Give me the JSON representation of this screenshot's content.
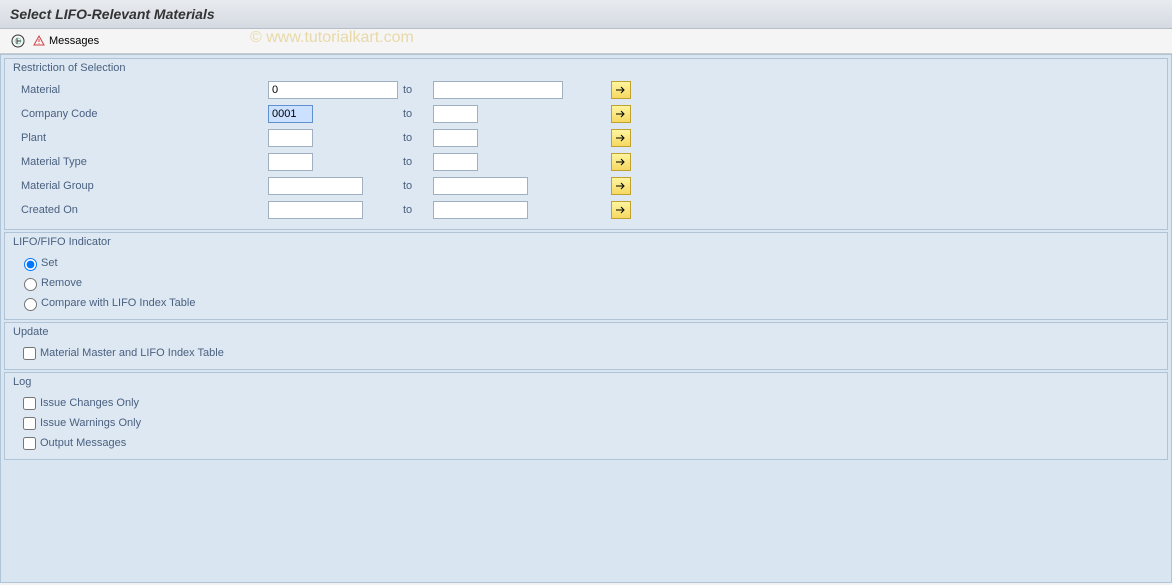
{
  "title": "Select LIFO-Relevant Materials",
  "watermark": "© www.tutorialkart.com",
  "toolbar": {
    "messages_label": "Messages"
  },
  "groups": {
    "restriction": {
      "title": "Restriction of Selection",
      "rows": [
        {
          "label": "Material",
          "from": "0",
          "to": "",
          "to_label": "to"
        },
        {
          "label": "Company Code",
          "from": "0001",
          "to": "",
          "to_label": "to"
        },
        {
          "label": "Plant",
          "from": "",
          "to": "",
          "to_label": "to"
        },
        {
          "label": "Material Type",
          "from": "",
          "to": "",
          "to_label": "to"
        },
        {
          "label": "Material Group",
          "from": "",
          "to": "",
          "to_label": "to"
        },
        {
          "label": "Created On",
          "from": "",
          "to": "",
          "to_label": "to"
        }
      ]
    },
    "indicator": {
      "title": "LIFO/FIFO Indicator",
      "options": [
        {
          "label": "Set",
          "checked": true
        },
        {
          "label": "Remove",
          "checked": false
        },
        {
          "label": "Compare with LIFO Index Table",
          "checked": false
        }
      ]
    },
    "update": {
      "title": "Update",
      "options": [
        {
          "label": "Material Master and LIFO Index Table",
          "checked": false
        }
      ]
    },
    "log": {
      "title": "Log",
      "options": [
        {
          "label": "Issue Changes Only",
          "checked": false
        },
        {
          "label": "Issue Warnings Only",
          "checked": false
        },
        {
          "label": "Output Messages",
          "checked": false
        }
      ]
    }
  }
}
